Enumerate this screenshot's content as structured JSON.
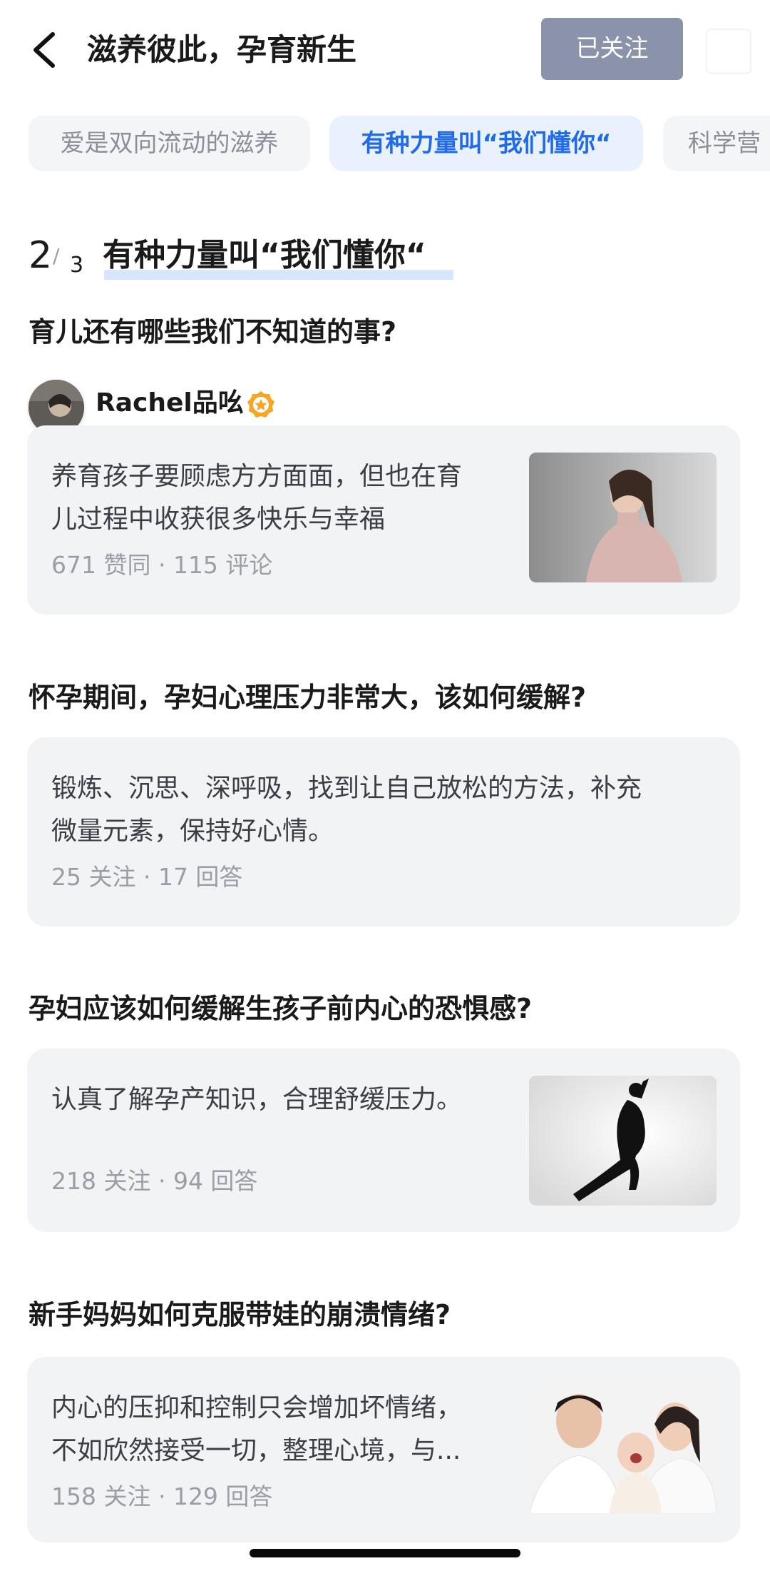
{
  "header": {
    "title": "滋养彼此，孕育新生",
    "follow_label": "已关注"
  },
  "tabs": [
    {
      "label": "爱是双向流动的滋养",
      "active": false
    },
    {
      "label": "有种力量叫“我们懂你“",
      "active": true
    },
    {
      "label": "科学营",
      "active": false
    }
  ],
  "section": {
    "index": "2",
    "total": "3",
    "title": "有种力量叫“我们懂你“"
  },
  "questions": [
    {
      "title": "育儿还有哪些我们不知道的事?",
      "author": "Rachel品吆",
      "answer_line1": "养育孩子要顾虑方方面面，但也在育",
      "answer_line2": "儿过程中收获很多快乐与幸福",
      "meta": "671 赞同 · 115 评论"
    },
    {
      "title": "怀孕期间，孕妇心理压力非常大，该如何缓解?",
      "answer_line1": "锻炼、沉思、深呼吸，找到让自己放松的方法，补充",
      "answer_line2": "微量元素，保持好心情。",
      "meta": "25 关注 · 17 回答"
    },
    {
      "title": "孕妇应该如何缓解生孩子前内心的恐惧感?",
      "answer_line1": "认真了解孕产知识，合理舒缓压力。",
      "meta": "218 关注 · 94 回答"
    },
    {
      "title": "新手妈妈如何克服带娃的崩溃情绪?",
      "answer_line1": "内心的压抑和控制只会增加坏情绪，",
      "answer_line2": "不如欣然接受一切，整理心境，与...",
      "meta": "158 关注 · 129 回答"
    }
  ],
  "colors": {
    "accent_blue": "#1f6bea",
    "follow_bg": "#8a93a9",
    "card_bg": "#f2f3f5",
    "meta_gray": "#9a9ea6"
  }
}
